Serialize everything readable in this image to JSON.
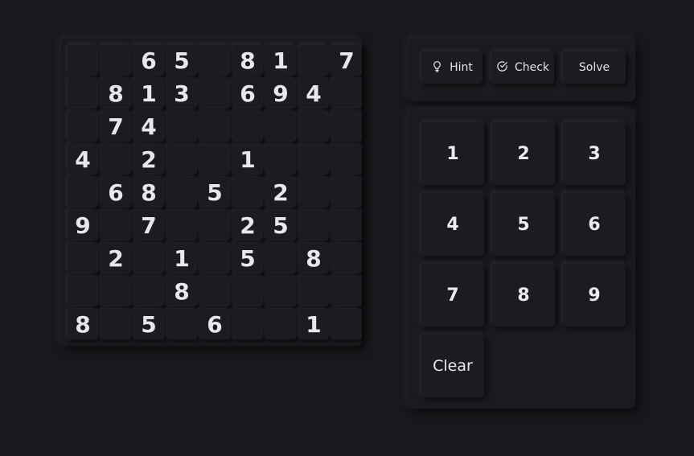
{
  "grid": [
    [
      "",
      "",
      "6",
      "5",
      "",
      "8",
      "1",
      "",
      "7"
    ],
    [
      "",
      "8",
      "1",
      "3",
      "",
      "6",
      "9",
      "4",
      ""
    ],
    [
      "",
      "7",
      "4",
      "",
      "",
      "",
      "",
      "",
      ""
    ],
    [
      "4",
      "",
      "2",
      "",
      "",
      "1",
      "",
      "",
      ""
    ],
    [
      "",
      "6",
      "8",
      "",
      "5",
      "",
      "2",
      "",
      ""
    ],
    [
      "9",
      "",
      "7",
      "",
      "",
      "2",
      "5",
      "",
      ""
    ],
    [
      "",
      "2",
      "",
      "1",
      "",
      "5",
      "",
      "8",
      ""
    ],
    [
      "",
      "",
      "",
      "8",
      "",
      "",
      "",
      "",
      ""
    ],
    [
      "8",
      "",
      "5",
      "",
      "6",
      "",
      "",
      "1",
      ""
    ]
  ],
  "actions": {
    "hint_label": "Hint",
    "check_label": "Check",
    "solve_label": "Solve"
  },
  "numpad": {
    "keys": [
      "1",
      "2",
      "3",
      "4",
      "5",
      "6",
      "7",
      "8",
      "9"
    ],
    "clear_label": "Clear"
  }
}
